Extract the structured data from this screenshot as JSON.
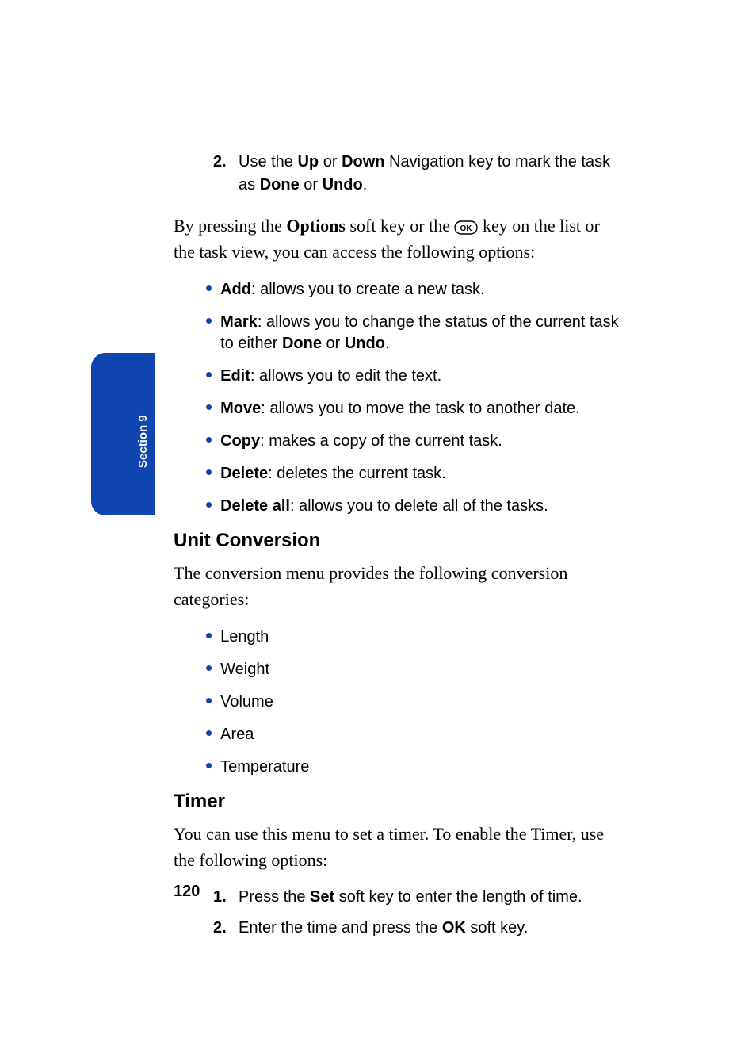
{
  "sectionTab": "Section 9",
  "steps_top": [
    {
      "num": "2.",
      "pre": "Use the ",
      "b1": "Up",
      "mid1": " or ",
      "b2": "Down",
      "mid2": " Navigation key to mark the task as ",
      "b3": "Done",
      "mid3": " or ",
      "b4": "Undo",
      "post": "."
    }
  ],
  "para_options": {
    "pre": "By pressing the ",
    "b1": "Options",
    "mid1": " soft key or the ",
    "mid2": " key on the list or the task view, you can access the following options:"
  },
  "opt_bullets": [
    {
      "b": "Add",
      "t": ": allows you to create a new task."
    },
    {
      "b": "Mark",
      "t": ": allows you to change the status of the current task to either ",
      "b2": "Done",
      "t2": " or ",
      "b3": "Undo",
      "t3": "."
    },
    {
      "b": "Edit",
      "t": ": allows you to edit the text."
    },
    {
      "b": "Move",
      "t": ": allows you to move the task to another date."
    },
    {
      "b": "Copy",
      "t": ": makes a copy of the current task."
    },
    {
      "b": "Delete",
      "t": ": deletes the current task."
    },
    {
      "b": "Delete all",
      "t": ": allows you to delete all of the tasks."
    }
  ],
  "h_unit": "Unit Conversion",
  "para_unit": "The conversion menu provides the following conversion categories:",
  "unit_bullets": [
    {
      "t": "Length"
    },
    {
      "t": "Weight"
    },
    {
      "t": "Volume"
    },
    {
      "t": "Area"
    },
    {
      "t": "Temperature"
    }
  ],
  "h_timer": "Timer",
  "para_timer": "You can use this menu to set a timer. To enable the Timer, use the following options:",
  "steps_timer": [
    {
      "num": "1.",
      "pre": "Press the ",
      "b1": "Set",
      "post": " soft key to enter the length of time."
    },
    {
      "num": "2.",
      "pre": "Enter the time and press the ",
      "b1": "OK",
      "post": " soft key."
    }
  ],
  "pageNumber": "120"
}
